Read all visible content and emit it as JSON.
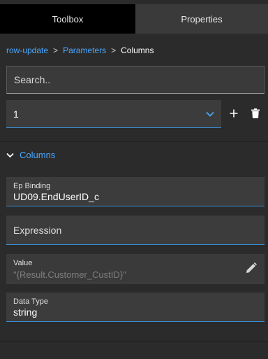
{
  "tabs": [
    {
      "label": "Toolbox"
    },
    {
      "label": "Properties"
    }
  ],
  "breadcrumb": {
    "items": [
      "row-update",
      "Parameters"
    ],
    "separator": ">",
    "current": "Columns"
  },
  "search": {
    "placeholder": "Search.."
  },
  "selector": {
    "value": "1"
  },
  "section": {
    "label": "Columns"
  },
  "fields": {
    "ep_binding": {
      "label": "Ep Binding",
      "value": "UD09.EndUserID_c"
    },
    "expression": {
      "label": "Expression"
    },
    "value": {
      "label": "Value",
      "value": "\"{Result.Customer_CustID}\""
    },
    "data_type": {
      "label": "Data Type",
      "value": "string"
    }
  },
  "colors": {
    "accent": "#4aa8ff",
    "background": "#2b2b2b",
    "field_bg": "#3c3c3c",
    "underline": "#3a8fd6"
  },
  "icons": [
    "chevron-down-icon",
    "plus-icon",
    "trash-icon",
    "chevron-down-icon",
    "pencil-icon"
  ]
}
